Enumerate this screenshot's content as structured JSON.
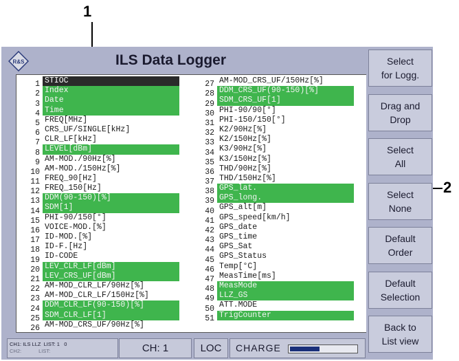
{
  "annotations": {
    "callout_1": "1",
    "callout_2": "2"
  },
  "title": "ILS Data Logger",
  "logo_text": "R&S",
  "list_left": [
    {
      "n": "1",
      "label": "STIOC",
      "selected": true,
      "cursor": true
    },
    {
      "n": "2",
      "label": "Index",
      "selected": true
    },
    {
      "n": "3",
      "label": "Date",
      "selected": true
    },
    {
      "n": "4",
      "label": "Time",
      "selected": true
    },
    {
      "n": "5",
      "label": "FREQ[MHz]",
      "selected": false
    },
    {
      "n": "6",
      "label": "CRS_UF/SINGLE[kHz]",
      "selected": false
    },
    {
      "n": "7",
      "label": "CLR_LF[kHz]",
      "selected": false
    },
    {
      "n": "8",
      "label": "LEVEL[dBm]",
      "selected": true
    },
    {
      "n": "9",
      "label": "AM-MOD./90Hz[%]",
      "selected": false
    },
    {
      "n": "10",
      "label": "AM-MOD./150Hz[%]",
      "selected": false
    },
    {
      "n": "11",
      "label": "FREQ_90[Hz]",
      "selected": false
    },
    {
      "n": "12",
      "label": "FREQ_150[Hz]",
      "selected": false
    },
    {
      "n": "13",
      "label": "DDM(90-150)[%]",
      "selected": true
    },
    {
      "n": "14",
      "label": "SDM[1]",
      "selected": true
    },
    {
      "n": "15",
      "label": "PHI-90/150[°]",
      "selected": false
    },
    {
      "n": "16",
      "label": "VOICE-MOD.[%]",
      "selected": false
    },
    {
      "n": "17",
      "label": "ID-MOD.[%]",
      "selected": false
    },
    {
      "n": "18",
      "label": "ID-F.[Hz]",
      "selected": false
    },
    {
      "n": "19",
      "label": "ID-CODE",
      "selected": false
    },
    {
      "n": "20",
      "label": "LEV_CLR_LF[dBm]",
      "selected": true
    },
    {
      "n": "21",
      "label": "LEV_CRS_UF[dBm]",
      "selected": true
    },
    {
      "n": "22",
      "label": "AM-MOD_CLR_LF/90Hz[%]",
      "selected": false
    },
    {
      "n": "23",
      "label": "AM-MOD_CLR_LF/150Hz[%]",
      "selected": false
    },
    {
      "n": "24",
      "label": "DDM_CLR_LF(90-150)[%]",
      "selected": true
    },
    {
      "n": "25",
      "label": "SDM_CLR_LF[1]",
      "selected": true
    },
    {
      "n": "26",
      "label": "AM-MOD_CRS_UF/90Hz[%]",
      "selected": false
    }
  ],
  "list_right": [
    {
      "n": "27",
      "label": "AM-MOD_CRS_UF/150Hz[%]",
      "selected": false
    },
    {
      "n": "28",
      "label": "DDM_CRS_UF(90-150)[%]",
      "selected": true
    },
    {
      "n": "29",
      "label": "SDM_CRS_UF[1]",
      "selected": true
    },
    {
      "n": "30",
      "label": "PHI-90/90[°]",
      "selected": false
    },
    {
      "n": "31",
      "label": "PHI-150/150[°]",
      "selected": false
    },
    {
      "n": "32",
      "label": "K2/90Hz[%]",
      "selected": false
    },
    {
      "n": "33",
      "label": "K2/150Hz[%]",
      "selected": false
    },
    {
      "n": "34",
      "label": "K3/90Hz[%]",
      "selected": false
    },
    {
      "n": "35",
      "label": "K3/150Hz[%]",
      "selected": false
    },
    {
      "n": "36",
      "label": "THD/90Hz[%]",
      "selected": false
    },
    {
      "n": "37",
      "label": "THD/150Hz[%]",
      "selected": false
    },
    {
      "n": "38",
      "label": "GPS_lat.",
      "selected": true
    },
    {
      "n": "39",
      "label": "GPS_long.",
      "selected": true
    },
    {
      "n": "40",
      "label": "GPS_alt[m]",
      "selected": false
    },
    {
      "n": "41",
      "label": "GPS_speed[km/h]",
      "selected": false
    },
    {
      "n": "42",
      "label": "GPS_date",
      "selected": false
    },
    {
      "n": "43",
      "label": "GPS_time",
      "selected": false
    },
    {
      "n": "44",
      "label": "GPS_Sat",
      "selected": false
    },
    {
      "n": "45",
      "label": "GPS_Status",
      "selected": false
    },
    {
      "n": "46",
      "label": "Temp[°C]",
      "selected": false
    },
    {
      "n": "47",
      "label": "MeasTime[ms]",
      "selected": false
    },
    {
      "n": "48",
      "label": "MeasMode",
      "selected": true
    },
    {
      "n": "49",
      "label": "LLZ_GS",
      "selected": true
    },
    {
      "n": "50",
      "label": "ATT.MODE",
      "selected": false
    },
    {
      "n": "51",
      "label": "TrigCounter",
      "selected": true
    }
  ],
  "softkeys": [
    {
      "line1": "Select",
      "line2": "for Logg."
    },
    {
      "line1": "Drag and",
      "line2": "Drop"
    },
    {
      "line1": "Select",
      "line2": "All"
    },
    {
      "line1": "Select",
      "line2": "None"
    },
    {
      "line1": "Default",
      "line2": "Order"
    },
    {
      "line1": "Default",
      "line2": "Selection"
    },
    {
      "line1": "Back to",
      "line2": "List view"
    }
  ],
  "status": {
    "ch1_prefix": "CH1:",
    "ch1_mode": "ILS LLZ",
    "ch1_list": "LIST: 1",
    "ch1_value": "0",
    "ch2_prefix": "CH2:",
    "ch2_list": "LIST:",
    "channel": "CH: 1",
    "mode": "LOC",
    "charge_label": "CHARGE",
    "charge_level": 0.45
  },
  "colors": {
    "selected_row": "#3fb54d",
    "cursor_row": "#2a2a2a",
    "device_frame": "#aeb2cb",
    "charge_fill": "#1a2f7a"
  }
}
